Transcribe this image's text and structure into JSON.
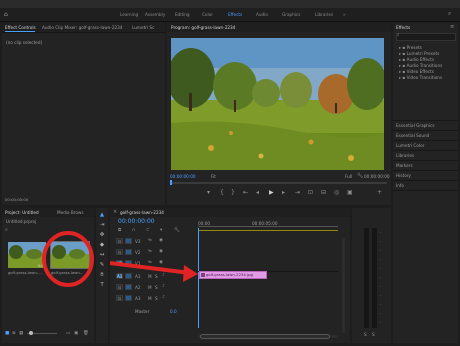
{
  "menu": [
    "File",
    "Edit",
    "Clip",
    "Sequence",
    "Markers",
    "Graphics",
    "Window",
    "Help"
  ],
  "workspaces": [
    "Learning",
    "Assembly",
    "Editing",
    "Color",
    "Effects",
    "Audio",
    "Graphics",
    "Libraries"
  ],
  "active_workspace": "Effects",
  "effect_controls": {
    "tabs": [
      "Effect Controls",
      "Audio Clip Mixer: golf-grass-lawn-2234",
      "Lumetri Sc"
    ],
    "empty_text": "(no clip selected)",
    "timecode": "00:00:00:00"
  },
  "program": {
    "tab": "Program: golf-grass-lawn-2234",
    "timecode_left": "00:00:00:00",
    "fit": "Fit",
    "full": "Full",
    "timecode_right": "00:00:00:00"
  },
  "effects": {
    "title": "Effects",
    "tree": [
      "Presets",
      "Lumetri Presets",
      "Audio Effects",
      "Audio Transitions",
      "Video Effects",
      "Video Transitions"
    ],
    "sections": [
      "Essential Graphics",
      "Essential Sound",
      "Lumetri Color",
      "Libraries",
      "Markers",
      "History",
      "Info"
    ]
  },
  "project": {
    "tabs": [
      "Project: Untitled",
      "Media Brows"
    ],
    "sub": "Untitled.prproj",
    "items": [
      {
        "name": "golf-grass-lawn-...",
        "duration": "5:00"
      },
      {
        "name": "golf-grass-lawn...",
        "duration": ""
      }
    ]
  },
  "timeline": {
    "tab": "golf-grass-lawn-2234",
    "timecode": "00:00:00:00",
    "ruler": [
      "00:00",
      "00:00:05:00"
    ],
    "video_tracks": [
      "V3",
      "V2",
      "V1"
    ],
    "audio_tracks": [
      "A1",
      "A2",
      "A3"
    ],
    "master": "Master",
    "master_value": "0.0",
    "clip_label": "golf-grass-lawn-2234.jpg"
  },
  "colors": {
    "accent": "#4aa0ff",
    "clip": "#e39ae6",
    "annotation": "#e02424"
  }
}
